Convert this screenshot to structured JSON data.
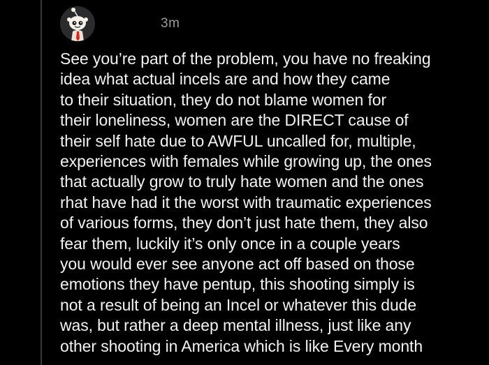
{
  "comment": {
    "age": "3m",
    "avatar_icon": "reddit-snoo-avatar-icon",
    "body_lines": [
      "See you’re part of the problem, you have no freaking",
      "idea what actual incels are and how they came",
      "to their situation, they do not blame women for",
      "their loneliness, women are the DIRECT cause of",
      "their self hate due to AWFUL uncalled for, multiple,",
      "experiences with females while growing up, the ones",
      "that actually grow to truly hate women and the ones",
      "rhat have had it the worst with traumatic experiences",
      "of various forms, they don’t just hate them, they also",
      "fear them, luckily it’s only once in a couple years",
      "you would ever see anyone act off based on those",
      "emotions they have pentup, this shooting simply is",
      "not a result of being an Incel or whatever this dude",
      "was, but rather a deep mental illness, just like any",
      "other shooting in America which is like Every month"
    ]
  },
  "colors": {
    "background": "#000000",
    "text": "#f2f2f2",
    "meta_text": "#9a9a9e",
    "thread_line": "#3a3a3c"
  }
}
